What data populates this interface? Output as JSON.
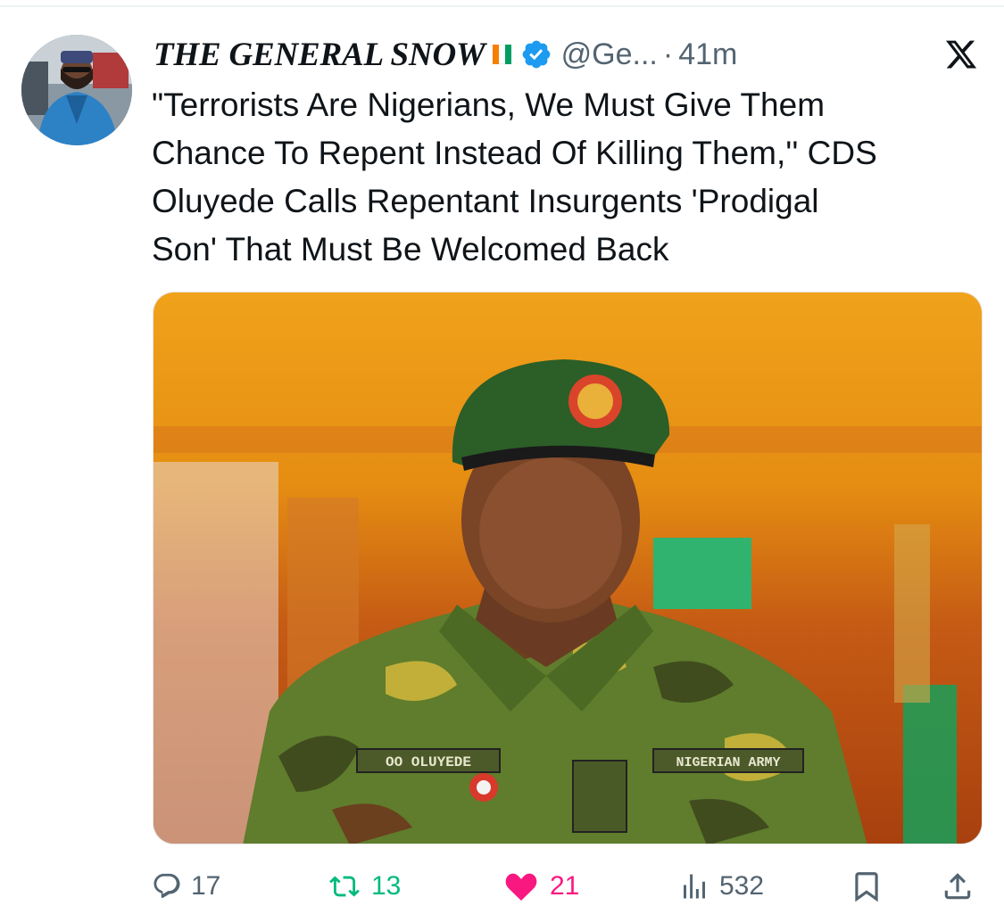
{
  "post": {
    "display_name": "THE GENERAL SNOW",
    "handle": "@Ge...",
    "separator": "·",
    "time": "41m",
    "text": "\"Terrorists Are Nigerians, We Must Give Them\nChance To Repent Instead Of Killing Them,'' CDS\nOluyede Calls Repentant Insurgents 'Prodigal\nSon' That Must Be Welcomed Back",
    "image": {
      "name_tape": "OO OLUYEDE",
      "branch_tape": "NIGERIAN ARMY",
      "icon": "soldier-portrait-photo"
    },
    "flag_colors": [
      "#f77f00",
      "#ffffff",
      "#009e60"
    ],
    "verified_color": "#1d9bf0"
  },
  "actions": {
    "replies": "17",
    "reposts": "13",
    "likes": "21",
    "views": "532",
    "icons": [
      "reply-icon",
      "repost-icon",
      "heart-icon",
      "views-icon",
      "bookmark-icon",
      "share-icon"
    ],
    "colors": {
      "reply": "#536471",
      "repost": "#00ba7c",
      "like": "#f91880",
      "views": "#536471"
    }
  }
}
